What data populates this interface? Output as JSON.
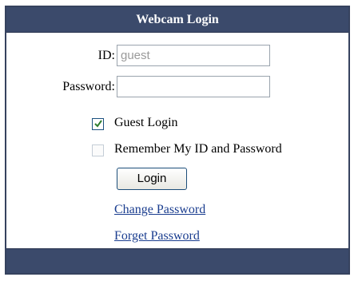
{
  "header": {
    "title": "Webcam Login"
  },
  "form": {
    "id_label": "ID:",
    "id_placeholder": "guest",
    "password_label": "Password:",
    "password_value": ""
  },
  "options": {
    "guest_login": {
      "label": "Guest Login",
      "checked": true
    },
    "remember": {
      "label": "Remember My ID and Password",
      "checked": false
    }
  },
  "buttons": {
    "login": "Login"
  },
  "links": {
    "change_password": "Change Password",
    "forget_password": "Forget Password"
  }
}
